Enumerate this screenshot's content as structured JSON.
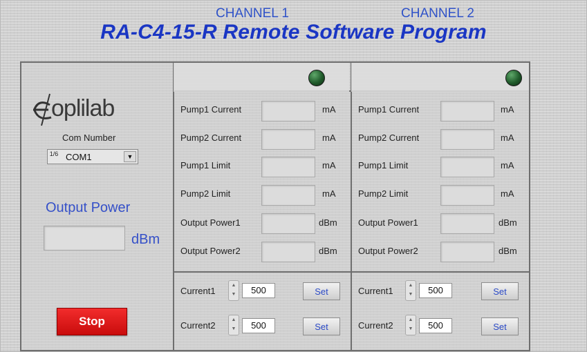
{
  "app_title": "RA-C4-15-R Remote Software Program",
  "logo_text": "oplilab",
  "com": {
    "label": "Com Number",
    "inc_icon": "1/6",
    "value": "COM1"
  },
  "output_power": {
    "label": "Output Power",
    "value": "",
    "unit": "dBm"
  },
  "stop_label": "Stop",
  "channels": [
    {
      "title": "CHANNEL 1",
      "rows": [
        {
          "label": "Pump1 Current",
          "value": "",
          "unit": "mA"
        },
        {
          "label": "Pump2 Current",
          "value": "",
          "unit": "mA"
        },
        {
          "label": "Pump1 Limit",
          "value": "",
          "unit": "mA"
        },
        {
          "label": "Pump2 Limit",
          "value": "",
          "unit": "mA"
        },
        {
          "label": "Output Power1",
          "value": "",
          "unit": "dBm"
        },
        {
          "label": "Output Power2",
          "value": "",
          "unit": "dBm"
        }
      ],
      "controls": [
        {
          "label": "Current1",
          "value": "500",
          "set_label": "Set"
        },
        {
          "label": "Current2",
          "value": "500",
          "set_label": "Set"
        }
      ]
    },
    {
      "title": "CHANNEL 2",
      "rows": [
        {
          "label": "Pump1 Current",
          "value": "",
          "unit": "mA"
        },
        {
          "label": "Pump2 Current",
          "value": "",
          "unit": "mA"
        },
        {
          "label": "Pump1 Limit",
          "value": "",
          "unit": "mA"
        },
        {
          "label": "Pump2 Limit",
          "value": "",
          "unit": "mA"
        },
        {
          "label": "Output Power1",
          "value": "",
          "unit": "dBm"
        },
        {
          "label": "Output Power2",
          "value": "",
          "unit": "dBm"
        }
      ],
      "controls": [
        {
          "label": "Current1",
          "value": "500",
          "set_label": "Set"
        },
        {
          "label": "Current2",
          "value": "500",
          "set_label": "Set"
        }
      ]
    }
  ],
  "colors": {
    "title_blue": "#1a36c4",
    "label_blue": "#3550c8",
    "stop_red": "#e01818",
    "led_green": "#1f5a2a"
  }
}
